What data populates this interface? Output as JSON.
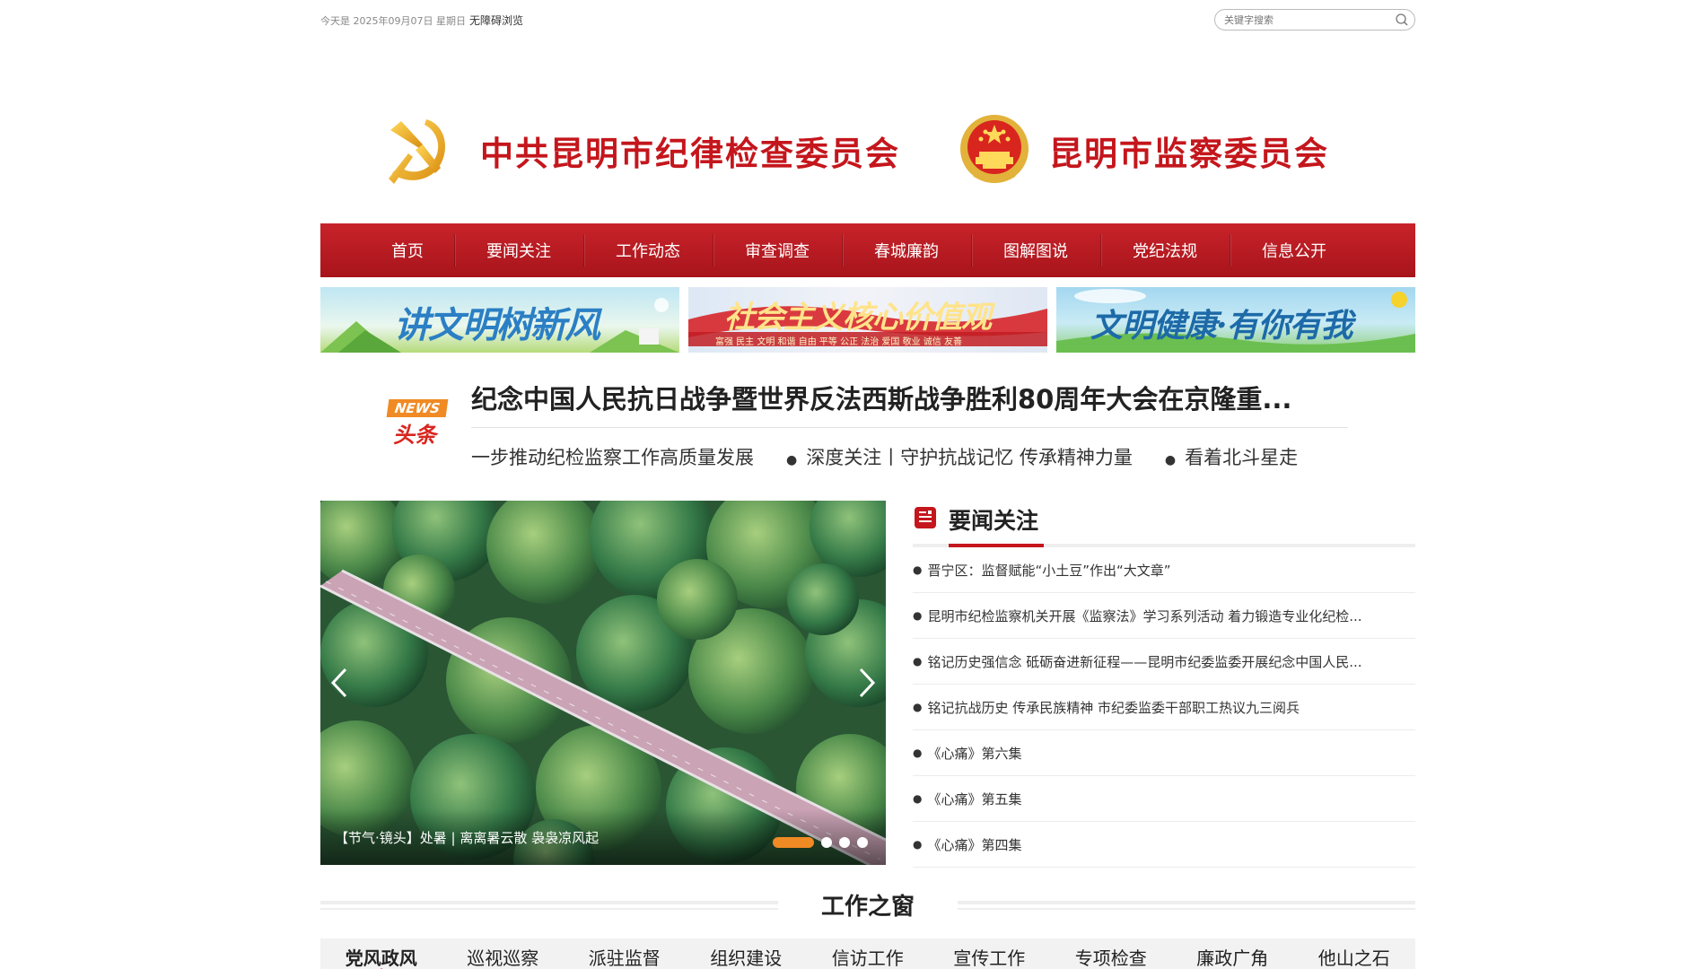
{
  "topbar": {
    "date_text": "今天是 2025年09月07日 星期日",
    "accessibility_label": "无障碍浏览",
    "search_placeholder": "关键字搜索"
  },
  "header": {
    "title_left": "中共昆明市纪律检查委员会",
    "title_right": "昆明市监察委员会"
  },
  "nav": {
    "items": [
      "首页",
      "要闻关注",
      "工作动态",
      "审查调查",
      "春城廉韵",
      "图解图说",
      "党纪法规",
      "信息公开"
    ]
  },
  "banners": {
    "b1_text": "讲文明树新风",
    "b2_text": "社会主义核心价值观",
    "b2_sub": "富强 民主 文明 和谐 自由 平等 公正 法治 爱国 敬业 诚信 友善",
    "b3_text": "文明健康·有你有我"
  },
  "headline": {
    "badge_top": "NEWS",
    "badge_bottom": "头条",
    "title": "纪念中国人民抗日战争暨世界反法西斯战争胜利80周年大会在京隆重...",
    "sub_items": [
      "一步推动纪检监察工作高质量发展",
      "深度关注丨守护抗战记忆 传承精神力量",
      "看着北斗星走"
    ]
  },
  "carousel": {
    "caption": "【节气·镜头】处暑 | 离离暑云散 袅袅凉风起",
    "slides_count": 4,
    "active_index": 0
  },
  "news": {
    "title": "要闻关注",
    "items": [
      "晋宁区：监督赋能“小土豆”作出“大文章”",
      "昆明市纪检监察机关开展《监察法》学习系列活动 着力锻造专业化纪检...",
      "铭记历史强信念 砥砺奋进新征程——昆明市纪委监委开展纪念中国人民...",
      "铭记抗战历史 传承民族精神 市纪委监委干部职工热议九三阅兵",
      "《心痛》第六集",
      "《心痛》第五集",
      "《心痛》第四集"
    ]
  },
  "work_window": {
    "title": "工作之窗",
    "tabs": [
      "党风政风",
      "巡视巡察",
      "派驻监督",
      "组织建设",
      "信访工作",
      "宣传工作",
      "专项检查",
      "廉政广角",
      "他山之石"
    ],
    "active_tab": 0
  },
  "colors": {
    "brand_red": "#c4161c",
    "accent_orange": "#f08a24"
  }
}
